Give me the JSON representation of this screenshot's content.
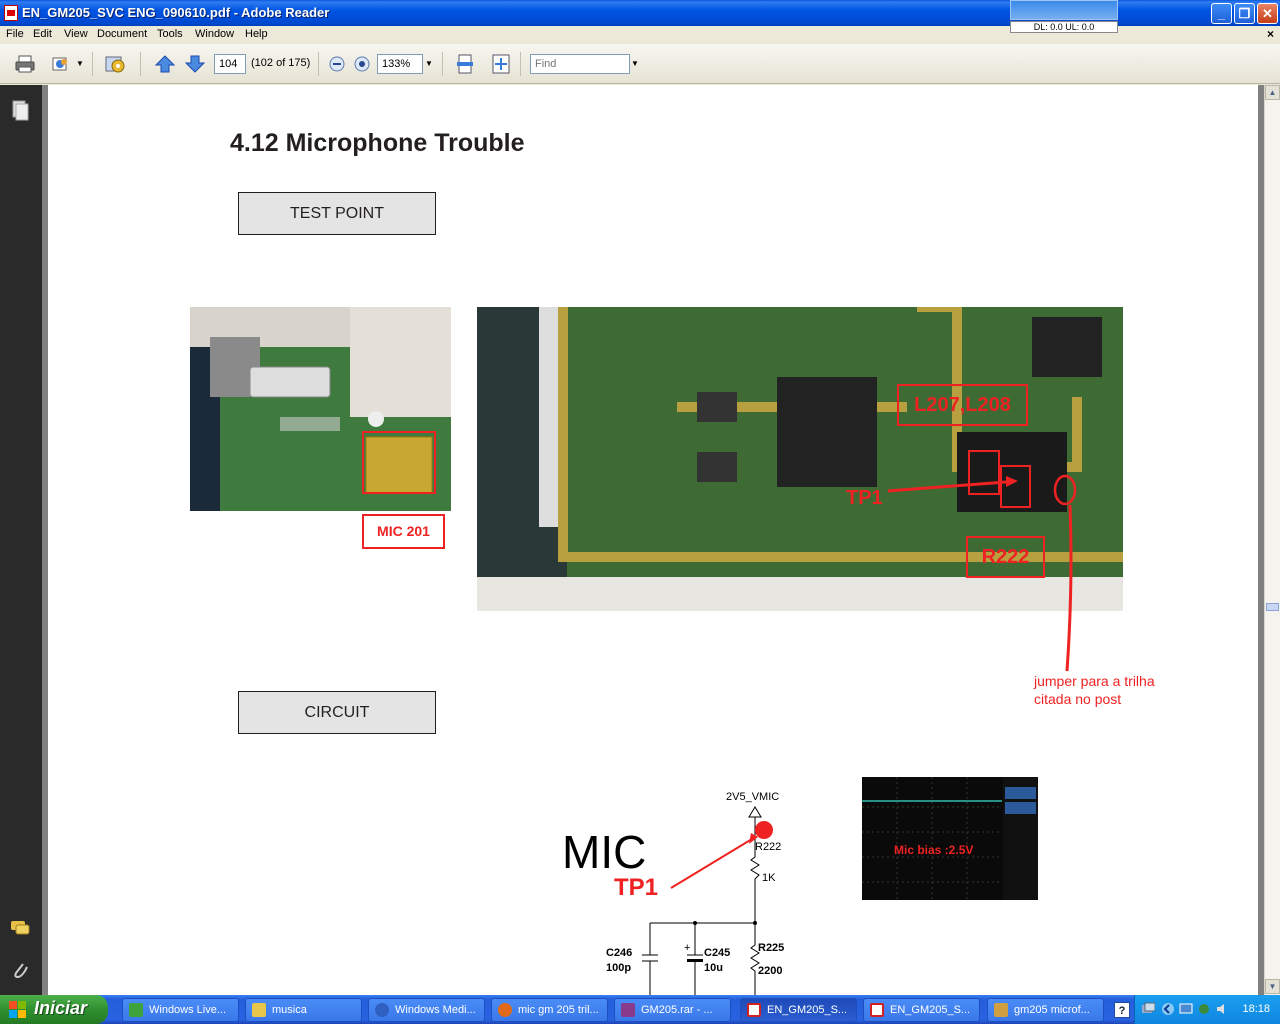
{
  "window": {
    "title": "EN_GM205_SVC ENG_090610.pdf - Adobe Reader",
    "overlay_text": "DL: 0.0 UL: 0.0",
    "minimize": "_",
    "maximize": "❐",
    "close": "✕"
  },
  "menu": {
    "items": [
      "File",
      "Edit",
      "View",
      "Document",
      "Tools",
      "Window",
      "Help"
    ],
    "doc_close": "×"
  },
  "toolbar": {
    "page_number": "104",
    "page_info": "(102 of 175)",
    "zoom": "133%",
    "find_placeholder": "Find"
  },
  "page": {
    "title": "4.12 Microphone Trouble",
    "test_point_label": "TEST POINT",
    "circuit_label": "CIRCUIT",
    "mic_label": "MIC 201",
    "board_labels": {
      "l207": "L207,L208",
      "tp1": "TP1",
      "r222": "R222"
    },
    "note": "jumper para a trilha\ncitada no post",
    "schematic": {
      "supply": "2V5_VMIC",
      "mic": "MIC",
      "tp1": "TP1",
      "r222": "R222",
      "r222_val": "1K",
      "c246": "C246",
      "c246_val": "100p",
      "c245": "C245",
      "c245_val": "10u",
      "r225": "R225",
      "r225_val": "2200"
    },
    "scope_label": "Mic bias :2.5V"
  },
  "taskbar": {
    "start": "Iniciar",
    "tasks": [
      {
        "label": "Windows Live...",
        "color": "#3da33d"
      },
      {
        "label": "musica",
        "color": "#e8c64a"
      },
      {
        "label": "Windows Medi...",
        "color": "#3060c0"
      },
      {
        "label": "mic gm 205 tril...",
        "color": "#e06a1a"
      },
      {
        "label": "GM205.rar - ...",
        "color": "#8a3a8a"
      },
      {
        "label": "EN_GM205_S...",
        "color": "#d02020"
      },
      {
        "label": "EN_GM205_S...",
        "color": "#d02020"
      },
      {
        "label": "gm205 microf...",
        "color": "#d0a040"
      }
    ],
    "clock": "18:18"
  }
}
